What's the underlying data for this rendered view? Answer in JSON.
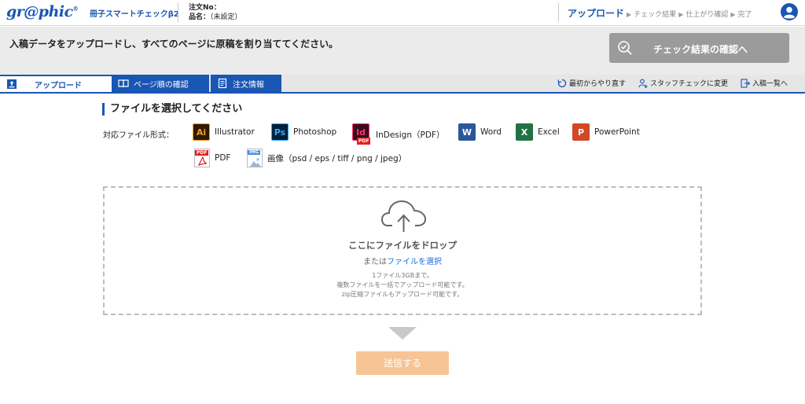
{
  "header": {
    "logo_text": "gr@phic",
    "logo_mark": "®",
    "app_name": "冊子スマートチェックβ2",
    "order_no_label": "注文No：",
    "order_no_value": "",
    "product_label": "品名：",
    "product_value": "（未設定）",
    "steps": {
      "current": "アップロード",
      "step2": "チェック結果",
      "step3": "仕上がり確認",
      "step4": "完了"
    }
  },
  "banner": {
    "message": "入稿データをアップロードし、すべてのページに原稿を割り当ててください。",
    "check_button": "チェック結果の確認へ"
  },
  "tabs": {
    "upload": "アップロード",
    "page_order": "ページ順の確認",
    "order_info": "注文情報"
  },
  "right_links": {
    "restart": "最初からやり直す",
    "staff_check": "スタッフチェックに変更",
    "submission_list": "入稿一覧へ"
  },
  "section_title": "ファイルを選択してください",
  "formats_label": "対応ファイル形式：",
  "formats": {
    "illustrator": "Illustrator",
    "photoshop": "Photoshop",
    "indesign": "InDesign（PDF）",
    "word": "Word",
    "excel": "Excel",
    "powerpoint": "PowerPoint",
    "pdf": "PDF",
    "image": "画像（psd / eps / tiff / png / jpeg）"
  },
  "icon_text": {
    "ai": "Ai",
    "ps": "Ps",
    "id": "Id",
    "id_badge": "PDF",
    "w": "W",
    "x": "X",
    "p": "P",
    "pdf_badge": "PDF",
    "img_badge": "IMG"
  },
  "dropzone": {
    "main": "ここにファイルをドロップ",
    "or": "または",
    "select_link": "ファイルを選択",
    "note1": "1ファイル3GBまで。",
    "note2": "複数ファイルを一括でアップロード可能です。",
    "note3": "zip圧縮ファイルもアップロード可能です。"
  },
  "send_button": "送信する",
  "colors": {
    "brand_blue": "#1a56b3",
    "send_button": "#f7c495",
    "check_button": "#9b9b9b"
  }
}
